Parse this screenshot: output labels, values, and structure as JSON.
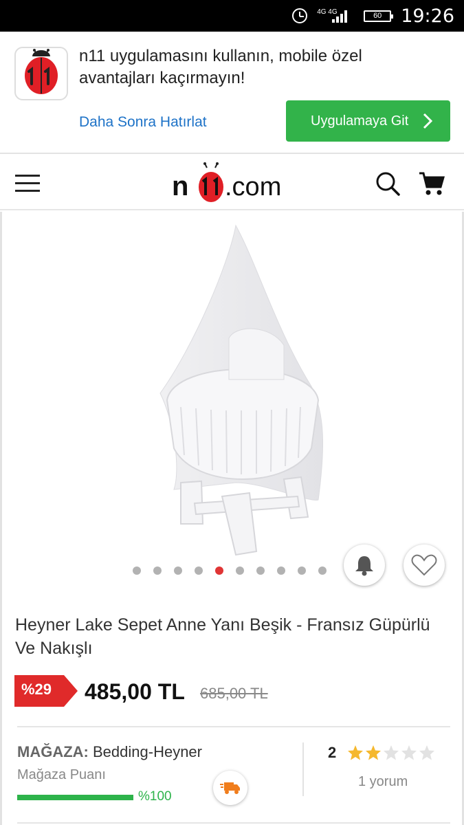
{
  "status_bar": {
    "time": "19:26",
    "network": "4G 4G",
    "battery": "60"
  },
  "banner": {
    "message": "n11 uygulamasını kullanın, mobile özel avantajları kaçırmayın!",
    "later_label": "Daha Sonra Hatırlat",
    "goto_label": "Uygulamaya Git"
  },
  "header": {
    "logo_text": "n11.com"
  },
  "product": {
    "title": "Heyner Lake Sepet Anne Yanı Beşik - Fransız Güpürlü Ve Nakışlı",
    "discount": "%29",
    "price": "485,00 TL",
    "old_price": "685,00 TL",
    "gallery": {
      "count": 10,
      "active_index": 4
    },
    "store": {
      "label": "MAĞAZA:",
      "name": "Bedding-Heyner",
      "score_label": "Mağaza Puanı",
      "score_percent": "%100"
    },
    "rating": {
      "value": "2",
      "stars": 2,
      "max": 5,
      "reviews": "1 yorum"
    }
  },
  "colors": {
    "accent_green": "#32b34a",
    "discount_red": "#e02a2a",
    "link_blue": "#1d72c7",
    "star": "#f5b82e"
  }
}
